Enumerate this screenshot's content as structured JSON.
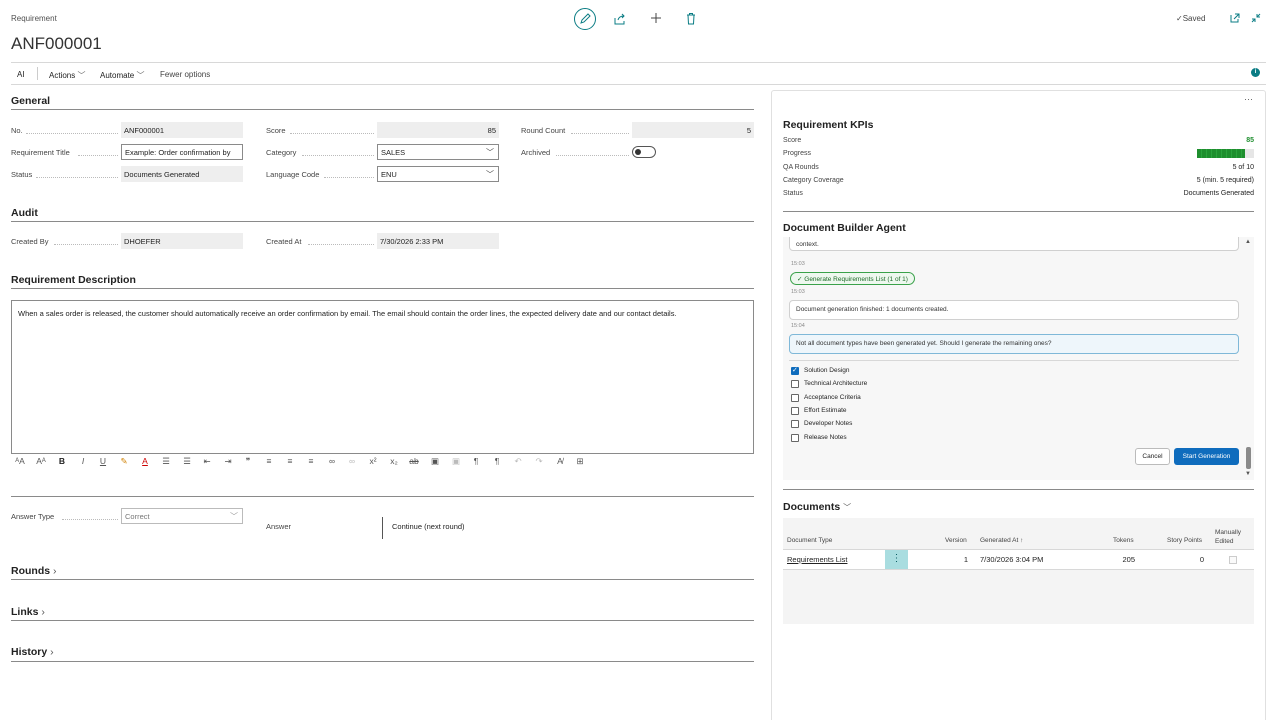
{
  "header": {
    "breadcrumb": "Requirement",
    "title": "ANF000001",
    "saved": "Saved"
  },
  "menu": {
    "ai": "AI",
    "actions": "Actions",
    "automate": "Automate",
    "fewer": "Fewer options"
  },
  "general": {
    "heading": "General",
    "no_label": "No.",
    "no_value": "ANF000001",
    "title_label": "Requirement Title",
    "title_value": "Example: Order confirmation by",
    "status_label": "Status",
    "status_value": "Documents Generated",
    "score_label": "Score",
    "score_value": "85",
    "category_label": "Category",
    "category_value": "SALES",
    "language_label": "Language Code",
    "language_value": "ENU",
    "round_label": "Round Count",
    "round_value": "5",
    "archived_label": "Archived"
  },
  "audit": {
    "heading": "Audit",
    "created_by_label": "Created By",
    "created_by_value": "DHOEFER",
    "created_at_label": "Created At",
    "created_at_value": "7/30/2026 2:33 PM"
  },
  "description": {
    "heading": "Requirement Description",
    "text": "When a sales order is released, the customer should automatically receive an order confirmation by email. The email should contain the order lines, the expected delivery date and our contact details."
  },
  "answer": {
    "type_label": "Answer Type",
    "type_value": "Correct",
    "answer_label": "Answer",
    "answer_value": "Continue (next round)"
  },
  "collapsed": {
    "rounds": "Rounds",
    "links": "Links",
    "history": "History"
  },
  "kpis": {
    "heading": "Requirement KPIs",
    "score_label": "Score",
    "score_value": "85",
    "progress_label": "Progress",
    "progress_fraction": 0.85,
    "qa_label": "QA Rounds",
    "qa_value": "5 of 10",
    "coverage_label": "Category Coverage",
    "coverage_value": "5 (min. 5 required)",
    "status_label": "Status",
    "status_value": "Documents Generated"
  },
  "agent": {
    "heading": "Document Builder Agent",
    "top_line1": "context.",
    "time1": "15:03",
    "chip": "Generate Requirements List (1 of 1)",
    "time2": "15:03",
    "msg1": "Document generation finished: 1 documents created.",
    "time3": "15:04",
    "question": "Not all document types have been generated yet. Should I generate the remaining ones?",
    "options": [
      {
        "label": "Solution Design",
        "checked": true
      },
      {
        "label": "Technical Architecture",
        "checked": false
      },
      {
        "label": "Acceptance Criteria",
        "checked": false
      },
      {
        "label": "Effort Estimate",
        "checked": false
      },
      {
        "label": "Developer Notes",
        "checked": false
      },
      {
        "label": "Release Notes",
        "checked": false
      }
    ],
    "cancel": "Cancel",
    "start": "Start Generation"
  },
  "documents": {
    "heading": "Documents",
    "col_type": "Document Type",
    "col_version": "Version",
    "col_generated": "Generated At",
    "col_tokens": "Tokens",
    "col_points": "Story Points",
    "col_manual1": "Manually",
    "col_manual2": "Edited",
    "row_type": "Requirements List",
    "row_version": "1",
    "row_generated": "7/30/2026 3:04 PM",
    "row_tokens": "205",
    "row_points": "0"
  },
  "colors": {
    "accent": "#0a7c84",
    "primary_button": "#0f6cbd",
    "progress": "#1e8e2e",
    "score": "#1e8e2e"
  }
}
